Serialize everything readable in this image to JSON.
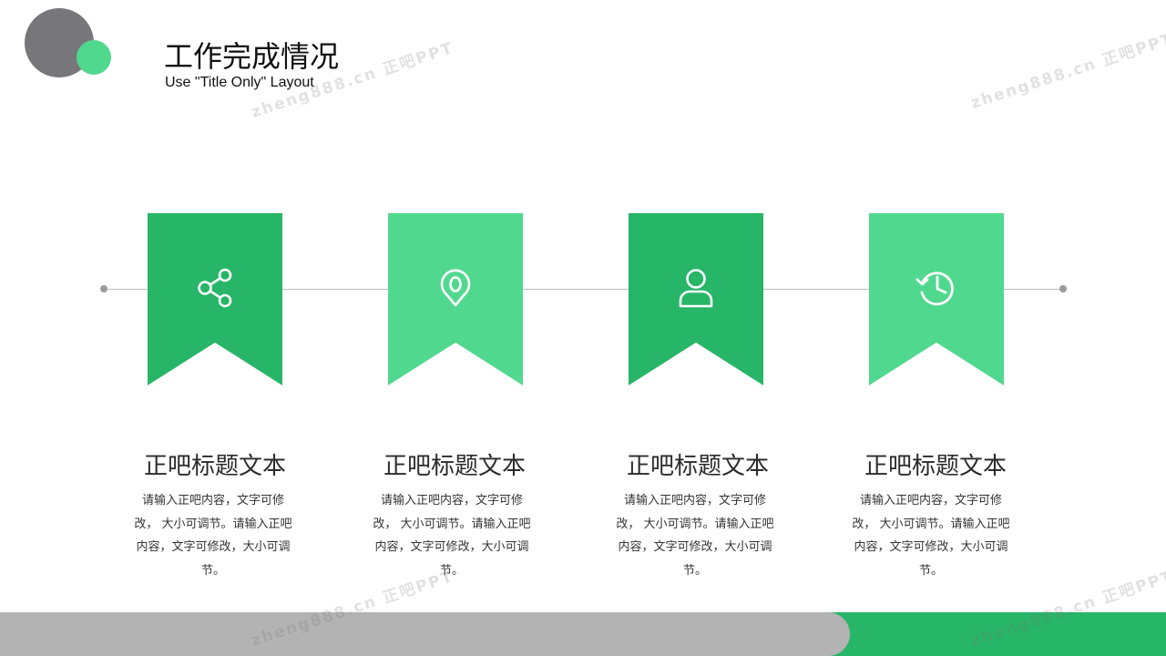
{
  "header": {
    "title": "工作完成情况",
    "subtitle": "Use \"Title Only\" Layout"
  },
  "watermark": {
    "text": "zheng888.cn 正吧PPT"
  },
  "colors": {
    "dark_green": "#27b567",
    "light_green": "#51d88f",
    "gray": "#77767b",
    "bottom_gray": "#b3b3b3"
  },
  "cards": [
    {
      "icon": "share-icon",
      "title": "正吧标题文本",
      "desc": "请输入正吧内容，文字可修改， 大小可调节。请输入正吧内容，文字可修改，大小可调节。"
    },
    {
      "icon": "location-pin-icon",
      "title": "正吧标题文本",
      "desc": "请输入正吧内容，文字可修改， 大小可调节。请输入正吧内容，文字可修改，大小可调节。"
    },
    {
      "icon": "user-icon",
      "title": "正吧标题文本",
      "desc": "请输入正吧内容，文字可修改， 大小可调节。请输入正吧内容，文字可修改，大小可调节。"
    },
    {
      "icon": "history-clock-icon",
      "title": "正吧标题文本",
      "desc": "请输入正吧内容，文字可修改， 大小可调节。请输入正吧内容，文字可修改，大小可调节。"
    }
  ]
}
